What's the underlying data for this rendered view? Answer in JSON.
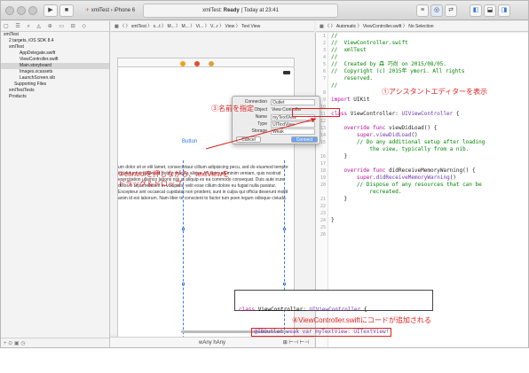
{
  "toolbar": {
    "scheme_app": "xmlTest",
    "scheme_device": "iPhone 6",
    "status_app": "xmlTest:",
    "status_state": "Ready",
    "status_time": "Today at 23:41"
  },
  "navigator": {
    "icons": "▢ ☰ ⌕ ◬ ⊕ ▭ ⊟ ◇",
    "items": [
      {
        "label": "xmlTest",
        "indent": 0
      },
      {
        "label": "2 targets, iOS SDK 8.4",
        "indent": 1
      },
      {
        "label": "xmlTest",
        "indent": 1
      },
      {
        "label": "AppDelegate.swift",
        "indent": 3
      },
      {
        "label": "ViewController.swift",
        "indent": 3
      },
      {
        "label": "Main.storyboard",
        "indent": 3,
        "selected": true
      },
      {
        "label": "Images.xcassets",
        "indent": 3
      },
      {
        "label": "LaunchScreen.xib",
        "indent": 3
      },
      {
        "label": "Supporting Files",
        "indent": 2
      },
      {
        "label": "xmlTestTests",
        "indent": 1
      },
      {
        "label": "Products",
        "indent": 1
      }
    ],
    "footer": "+ ⊙ ▣ ◷"
  },
  "jumpbar_left": "▦ 〈 〉 xmlTest 〉 x...t 〉 M... 〉 M... 〉 Vi... 〉 V...r 〉 View 〉 Text View",
  "jumpbar_right": "▦ 〈 〉 Automatic 〉 ViewController.swift 〉 No Selection",
  "canvas": {
    "button_label": "Button",
    "lorem": "um dolor sit er elit lamet, consectetaur cillium adipisicing pecu, sed do eiusmod tempor incididunt ut labore et dolore magna aliqua. Ut enim ad minim veniam, quis nostrud exercitation ullamco laboris nisi ut aliquip ex ea commodo consequat. Duis aute irure dolor in reprehenderit in voluptate velit esse cillum dolore eu fugiat nulla pariatur. Excepteur sint occaecat cupidatat non proident, sunt in culpa qui officia deserunt mollit anim id est laborum. Nam liber te conscient to factor tum poen legum odioque civiuda.",
    "footer_size": "wAny hAny",
    "footer_right": "⊞ ⊢⊣ ⊢⊣"
  },
  "popup": {
    "connection_label": "Connection",
    "connection_value": "Outlet",
    "object_label": "Object",
    "object_value": "View Controller",
    "name_label": "Name",
    "name_value": "myTextView",
    "type_label": "Type",
    "type_value": "UITextView",
    "storage_label": "Storage",
    "storage_value": "Weak",
    "cancel": "Cancel",
    "connect": "Connect"
  },
  "code": {
    "line_numbers": [
      "1",
      "2",
      "3",
      "4",
      "5",
      "6",
      "7",
      "",
      "8",
      "9",
      "10",
      "11",
      "12",
      "13",
      "14",
      "15",
      "",
      "16",
      "17",
      "18",
      "19",
      "20",
      "",
      "21",
      "22",
      "23",
      "24",
      "25",
      "26"
    ],
    "lines": [
      [
        {
          "t": "//",
          "c": "cmt"
        }
      ],
      [
        {
          "t": "//  ViewController.swift",
          "c": "cmt"
        }
      ],
      [
        {
          "t": "//  xmlTest",
          "c": "cmt"
        }
      ],
      [
        {
          "t": "//",
          "c": "cmt"
        }
      ],
      [
        {
          "t": "//  Created by 森 巧尚 on 2015/08/05.",
          "c": "cmt"
        }
      ],
      [
        {
          "t": "//  Copyright (c) 2015年 ymori. All rights",
          "c": "cmt"
        }
      ],
      [
        {
          "t": "    reserved.",
          "c": "cmt"
        }
      ],
      [
        {
          "t": "//",
          "c": "cmt"
        }
      ],
      [
        {
          "t": "",
          "c": "plain"
        }
      ],
      [
        {
          "t": "import ",
          "c": "kw"
        },
        {
          "t": "UIKit",
          "c": "plain"
        }
      ],
      [
        {
          "t": "",
          "c": "plain"
        }
      ],
      [
        {
          "t": "class ",
          "c": "kw"
        },
        {
          "t": "ViewController: ",
          "c": "plain"
        },
        {
          "t": "UIViewController",
          "c": "ty"
        },
        {
          "t": " {",
          "c": "plain"
        }
      ],
      [
        {
          "t": "",
          "c": "plain"
        }
      ],
      [
        {
          "t": "    override func ",
          "c": "kw"
        },
        {
          "t": "viewDidLoad() {",
          "c": "plain"
        }
      ],
      [
        {
          "t": "        super",
          "c": "kw"
        },
        {
          "t": ".",
          "c": "plain"
        },
        {
          "t": "viewDidLoad",
          "c": "ty"
        },
        {
          "t": "()",
          "c": "plain"
        }
      ],
      [
        {
          "t": "        // Do any additional setup after loading",
          "c": "cmt"
        }
      ],
      [
        {
          "t": "            the view, typically from a nib.",
          "c": "cmt"
        }
      ],
      [
        {
          "t": "    }",
          "c": "plain"
        }
      ],
      [
        {
          "t": "",
          "c": "plain"
        }
      ],
      [
        {
          "t": "    override func ",
          "c": "kw"
        },
        {
          "t": "didReceiveMemoryWarning() {",
          "c": "plain"
        }
      ],
      [
        {
          "t": "        super",
          "c": "kw"
        },
        {
          "t": ".",
          "c": "plain"
        },
        {
          "t": "didReceiveMemoryWarning",
          "c": "ty"
        },
        {
          "t": "()",
          "c": "plain"
        }
      ],
      [
        {
          "t": "        // Dispose of any resources that can be",
          "c": "cmt"
        }
      ],
      [
        {
          "t": "            recreated.",
          "c": "cmt"
        }
      ],
      [
        {
          "t": "    }",
          "c": "plain"
        }
      ],
      [
        {
          "t": "",
          "c": "plain"
        }
      ],
      [
        {
          "t": "",
          "c": "plain"
        }
      ],
      [
        {
          "t": "}",
          "c": "plain"
        }
      ],
      [
        {
          "t": "",
          "c": "plain"
        }
      ],
      [
        {
          "t": "",
          "c": "plain"
        }
      ]
    ]
  },
  "overlay": {
    "line1_kw": "class ",
    "line1_name": "ViewController: ",
    "line1_type": "UIViewController",
    "line1_end": " {",
    "line2": "@IBOutlet weak var myTextView: UITextView!"
  },
  "annotations": {
    "a1": "①アシスタントエディターを表示",
    "a2_line1": "②controlを押しながら、textViewを",
    "a2_line2": "ドラッグ＆ドロップ",
    "a3": "③名前を指定",
    "a4": "④ViewController.swiftにコードが追加される"
  },
  "colors": {
    "annotation": "#e02020",
    "comment": "#008400",
    "keyword": "#b40e9a",
    "type": "#6b36a9"
  }
}
